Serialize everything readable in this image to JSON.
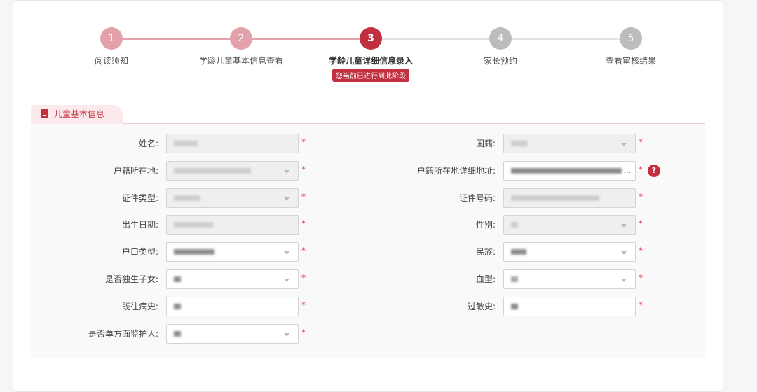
{
  "steps": [
    {
      "num": "1",
      "label": "阅读须知",
      "state": "done"
    },
    {
      "num": "2",
      "label": "学龄儿童基本信息查看",
      "state": "done"
    },
    {
      "num": "3",
      "label": "学龄儿童详细信息录入",
      "state": "current",
      "badge": "您当前已进行到此阶段"
    },
    {
      "num": "4",
      "label": "家长预约",
      "state": "todo"
    },
    {
      "num": "5",
      "label": "查看审核结果",
      "state": "todo"
    }
  ],
  "section": {
    "title": "儿童基本信息"
  },
  "form": {
    "left": [
      {
        "label": "姓名:",
        "type": "text",
        "disabled": true
      },
      {
        "label": "户籍所在地:",
        "type": "select",
        "disabled": true
      },
      {
        "label": "证件类型:",
        "type": "select",
        "disabled": true
      },
      {
        "label": "出生日期:",
        "type": "text",
        "disabled": true
      },
      {
        "label": "户口类型:",
        "type": "select",
        "disabled": false
      },
      {
        "label": "是否独生子女:",
        "type": "select",
        "disabled": false
      },
      {
        "label": "既往病史:",
        "type": "text",
        "disabled": false
      },
      {
        "label": "是否单方面监护人:",
        "type": "select",
        "disabled": false
      }
    ],
    "right": [
      {
        "label": "国籍:",
        "type": "select",
        "disabled": true
      },
      {
        "label": "户籍所在地详细地址:",
        "type": "text",
        "disabled": false,
        "ellipsis": "..."
      },
      {
        "label": "证件号码:",
        "type": "text",
        "disabled": true
      },
      {
        "label": "性别:",
        "type": "select",
        "disabled": true
      },
      {
        "label": "民族:",
        "type": "select",
        "disabled": false
      },
      {
        "label": "血型:",
        "type": "select",
        "disabled": false
      },
      {
        "label": "过敏史:",
        "type": "text",
        "disabled": false
      }
    ],
    "required_mark": "*",
    "help_icon": "?"
  },
  "colors": {
    "accent": "#c1303f",
    "done": "#e3a2ab",
    "todo": "#bcbcbc"
  }
}
